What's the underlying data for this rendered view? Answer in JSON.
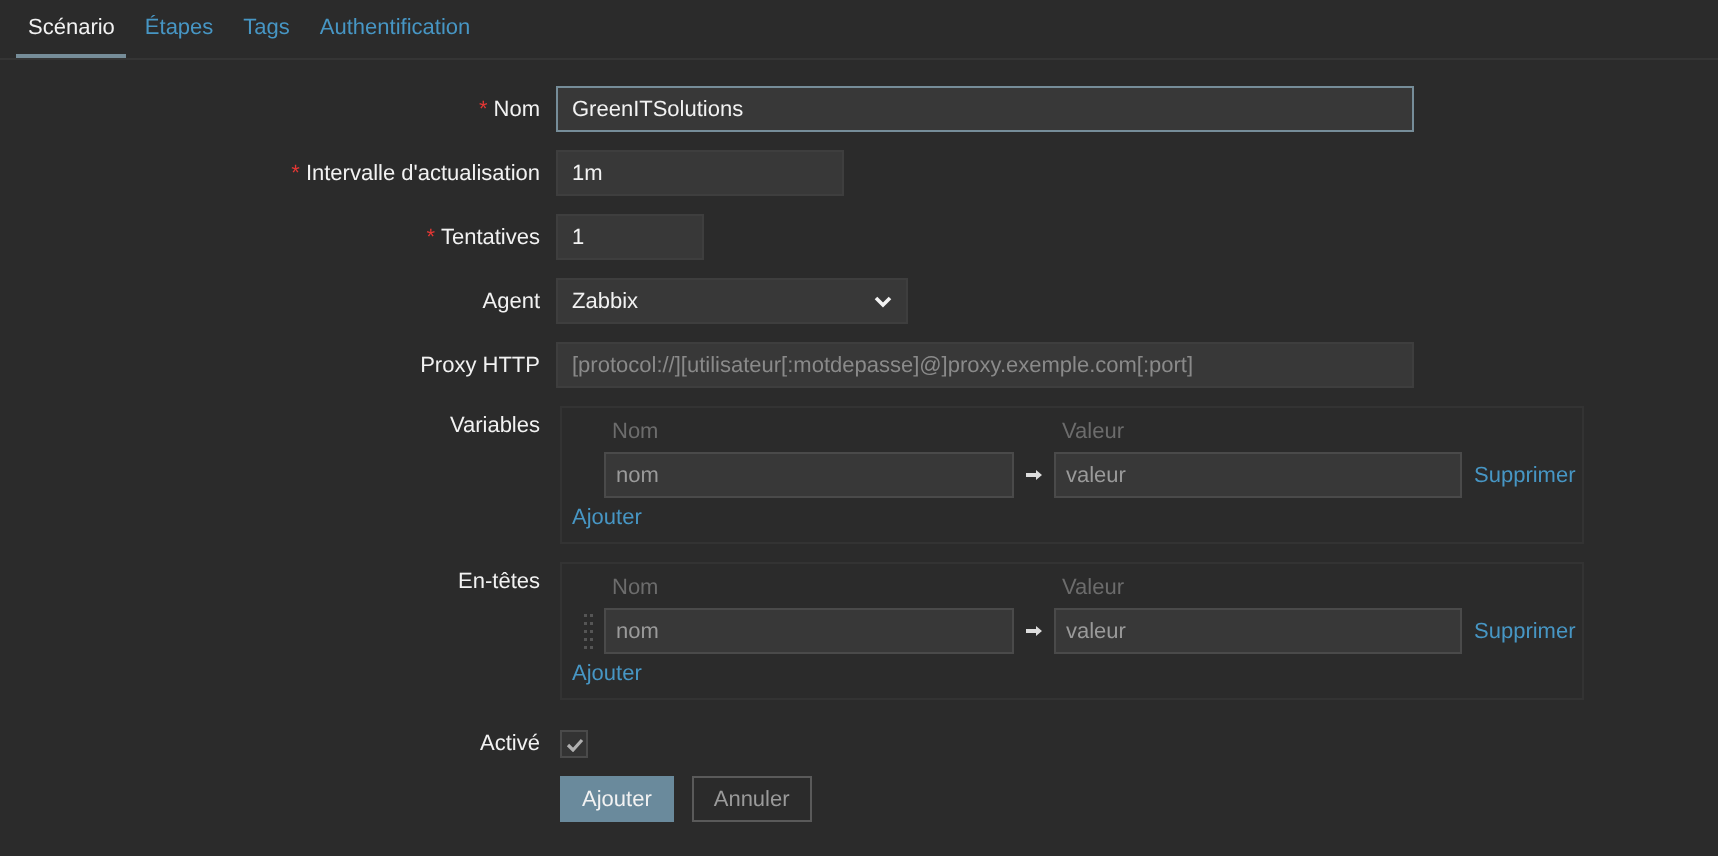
{
  "required_mark": "*",
  "tabs": [
    {
      "label": "Scénario",
      "selected": true
    },
    {
      "label": "Étapes",
      "selected": false
    },
    {
      "label": "Tags",
      "selected": false
    },
    {
      "label": "Authentification",
      "selected": false
    }
  ],
  "fields": [
    {
      "kind": "text",
      "label": "Nom",
      "required": true,
      "value": "GreenITSolutions"
    },
    {
      "kind": "text",
      "label": "Intervalle d'actualisation",
      "required": true,
      "value": "1m"
    },
    {
      "kind": "text",
      "label": "Tentatives",
      "required": true,
      "value": "1"
    },
    {
      "kind": "select",
      "label": "Agent",
      "required": false,
      "value": "Zabbix"
    },
    {
      "kind": "text",
      "label": "Proxy HTTP",
      "required": false,
      "placeholder": "[protocol://][utilisateur[:motdepasse]@]proxy.exemple.com[:port]"
    }
  ],
  "tables": [
    {
      "label": "Variables",
      "name_header": "Nom",
      "value_header": "Valeur",
      "add": "Ajouter",
      "rows": [
        {
          "draggable": false,
          "name_placeholder": "nom",
          "value_placeholder": "valeur",
          "remove": "Supprimer"
        }
      ]
    },
    {
      "label": "En-têtes",
      "name_header": "Nom",
      "value_header": "Valeur",
      "add": "Ajouter",
      "rows": [
        {
          "draggable": true,
          "name_placeholder": "nom",
          "value_placeholder": "valeur",
          "remove": "Supprimer"
        }
      ]
    }
  ],
  "enabled": {
    "label": "Activé",
    "checked": true,
    "disabled": true
  },
  "buttons": [
    {
      "label": "Ajouter",
      "kind": "primary"
    },
    {
      "label": "Annuler",
      "kind": "secondary"
    }
  ]
}
